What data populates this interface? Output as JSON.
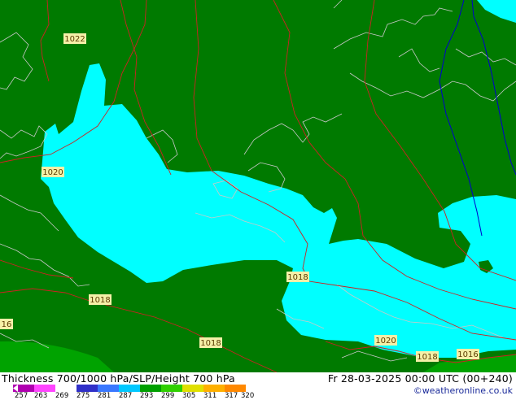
{
  "map": {
    "pressure_labels": [
      "1022",
      "1020",
      "1018",
      "1018",
      "1018",
      "1020",
      "1018",
      "1016",
      "16"
    ],
    "colors": {
      "land_thickness_low": "#007a00",
      "thickness_band": "#00ffff",
      "thickness_high_band": "#00a300",
      "isobar": "#cc2222",
      "coastline": "#c8c8c8",
      "contour_700": "#0000cc",
      "label_bg": "#f5f0a8"
    }
  },
  "footer": {
    "title": "Thickness 700/1000 hPa/SLP/Height 700 hPa",
    "datetime": "Fr 28-03-2025 00:00 UTC (00+240)",
    "credit": "©weatheronline.co.uk",
    "legend": {
      "ticks": [
        "257",
        "263",
        "269",
        "275",
        "281",
        "287",
        "293",
        "299",
        "305",
        "311",
        "317",
        "320"
      ],
      "colors": [
        "#b000b0",
        "#ff44ff",
        "#ffffff",
        "#3030c8",
        "#3a78ff",
        "#00c8ff",
        "#00a000",
        "#30d000",
        "#e0e000",
        "#ffb000",
        "#ff8800"
      ]
    }
  }
}
